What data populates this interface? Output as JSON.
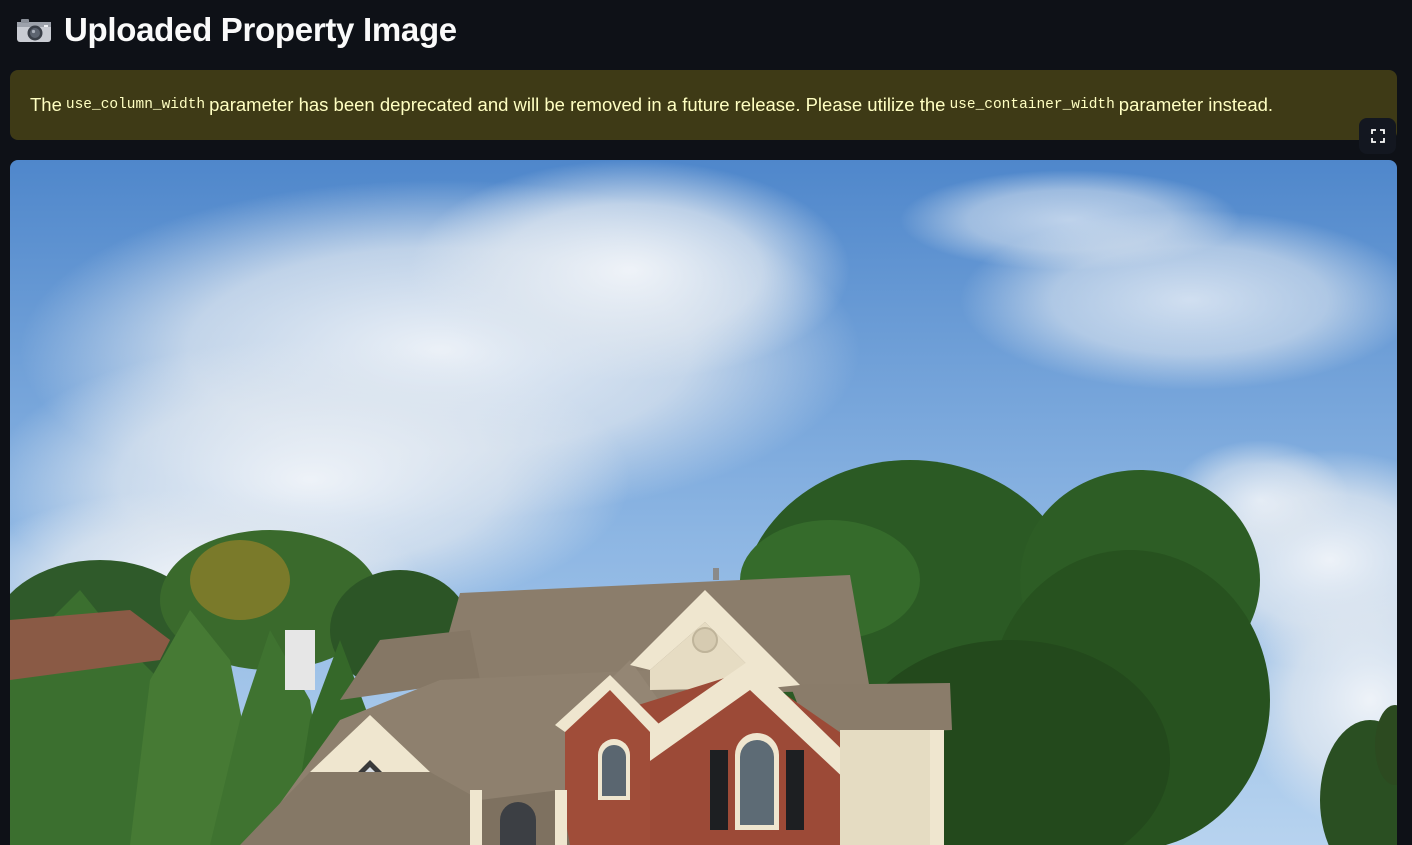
{
  "header": {
    "icon": "camera-icon",
    "title": "Uploaded Property Image"
  },
  "warning": {
    "text_1": "The",
    "code_1": "use_column_width",
    "text_2": "parameter has been deprecated and will be removed in a future release. Please utilize the",
    "code_2": "use_container_width",
    "text_3": "parameter instead.",
    "background": "#3e3a16",
    "text_color": "#ffffc2"
  },
  "toolbar": {
    "fullscreen_icon": "fullscreen-icon"
  },
  "image": {
    "subject": "house-photo"
  },
  "colors": {
    "app_background": "#0e1117",
    "title_text": "#fafafa"
  }
}
